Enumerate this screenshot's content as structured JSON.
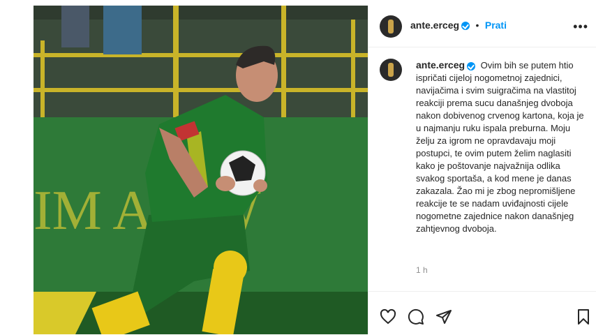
{
  "post": {
    "username": "ante.erceg",
    "follow_label": "Prati",
    "more_label": "•••",
    "caption": "Ovim bih se putem htio ispričati cijeloj nogometnoj zajednici, navijačima i svim suigračima na vlastitoj reakciji prema sucu današnjeg dvoboja nakon dobivenog crvenog kartona, koja je u najmanju ruku ispala preburna. Moju želju za igrom ne opravdavaju moji postupci, te ovim putem želim naglasiti kako je poštovanje najvažnija odlika svakog sportaša, a kod mene je danas zakazala. Žao mi je zbog nepromišljene reakcije te se nadam uviđajnosti cijele nogometne zajednice nakon današnjeg zahtjevnog dvoboja.",
    "time": "1 h"
  },
  "photo": {
    "banner_text": "IM A   'TW"
  },
  "colors": {
    "link": "#0095f6",
    "jersey_green": "#1f7a2e",
    "jersey_yellow": "#f2d21b"
  },
  "icons": [
    "heart-icon",
    "comment-icon",
    "share-icon",
    "bookmark-icon",
    "more-icon",
    "verified-icon"
  ]
}
